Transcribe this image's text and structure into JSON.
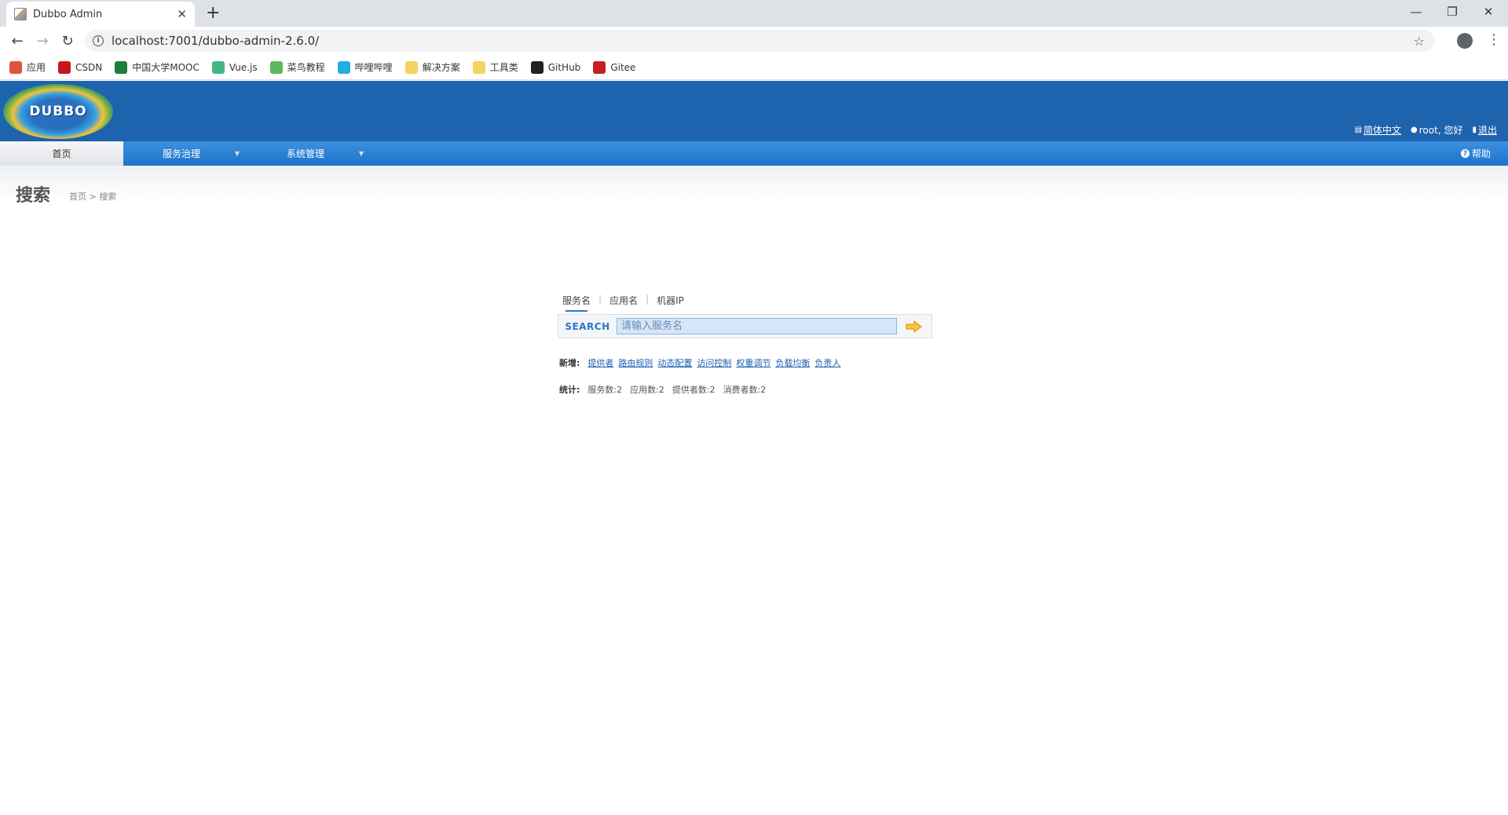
{
  "browser": {
    "tab_title": "Dubbo Admin",
    "url": "localhost:7001/dubbo-admin-2.6.0/",
    "bookmarks": [
      {
        "label": "应用",
        "icon": "apps-grid-icon",
        "color": "#e0533b"
      },
      {
        "label": "CSDN",
        "icon": "csdn-icon",
        "color": "#c8161d"
      },
      {
        "label": "中国大学MOOC",
        "icon": "mooc-icon",
        "color": "#1e7d3a"
      },
      {
        "label": "Vue.js",
        "icon": "vue-icon",
        "color": "#41b883"
      },
      {
        "label": "菜鸟教程",
        "icon": "runoob-icon",
        "color": "#5cb85c"
      },
      {
        "label": "哔哩哔哩",
        "icon": "bilibili-icon",
        "color": "#23ade5"
      },
      {
        "label": "解决方案",
        "icon": "folder-icon",
        "color": "#f4d35e"
      },
      {
        "label": "工具类",
        "icon": "folder-icon",
        "color": "#f4d35e"
      },
      {
        "label": "GitHub",
        "icon": "github-icon",
        "color": "#222222"
      },
      {
        "label": "Gitee",
        "icon": "gitee-icon",
        "color": "#c71d23"
      }
    ]
  },
  "header": {
    "logo_text": "DUBBO",
    "language": "简体中文",
    "greeting": "root, 您好",
    "logout": "退出"
  },
  "menu": {
    "items": [
      {
        "label": "首页",
        "active": true
      },
      {
        "label": "服务治理",
        "dropdown": true
      },
      {
        "label": "系统管理",
        "dropdown": true
      }
    ],
    "help": "帮助"
  },
  "page": {
    "title": "搜索",
    "breadcrumb": [
      "首页",
      ">",
      "搜索"
    ]
  },
  "search": {
    "tabs": [
      "服务名",
      "应用名",
      "机器IP"
    ],
    "active_tab": "服务名",
    "label": "SEARCH",
    "placeholder": "请输入服务名",
    "value": ""
  },
  "quick_add": {
    "label": "新增:",
    "links": [
      "提供者",
      "路由规则",
      "动态配置",
      "访问控制",
      "权重调节",
      "负载均衡",
      "负责人"
    ]
  },
  "stats": {
    "label": "统计:",
    "items": [
      "服务数:2",
      "应用数:2",
      "提供者数:2",
      "消费者数:2"
    ]
  },
  "colors": {
    "header_bg": "#1e63ad",
    "menu_bg": "#1f73c9",
    "link": "#1d5fb0",
    "search_accent": "#2a75c8",
    "arrow": "#f0a81c"
  }
}
